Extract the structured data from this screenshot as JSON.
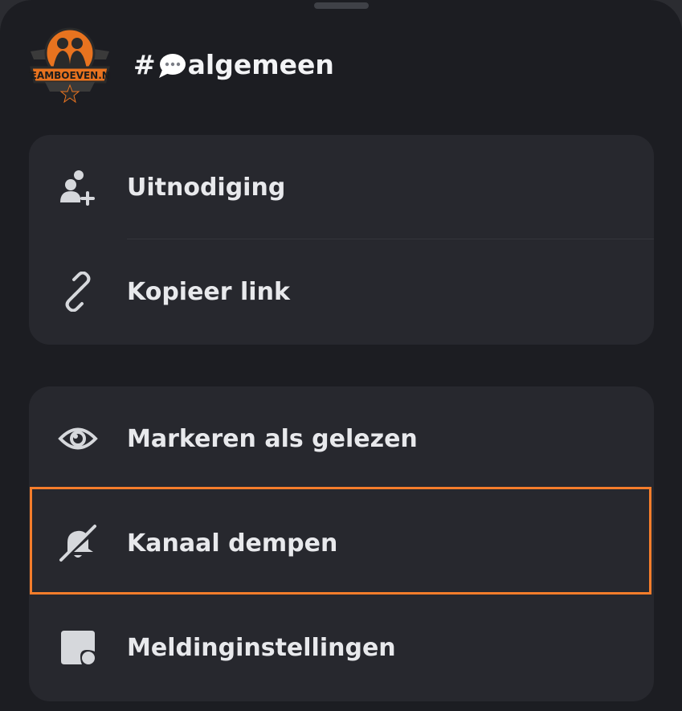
{
  "header": {
    "server_logo_text": "TEAMBOEVEN.NL",
    "channel_prefix": "#",
    "channel_emoji": "speech-bubble-emoji",
    "channel_name": "algemeen"
  },
  "groups": [
    {
      "items": [
        {
          "label": "Uitnodiging",
          "icon": "add-friend-icon"
        },
        {
          "label": "Kopieer link",
          "icon": "link-icon"
        }
      ]
    },
    {
      "items": [
        {
          "label": "Markeren als gelezen",
          "icon": "eye-icon"
        },
        {
          "label": "Kanaal dempen",
          "icon": "bell-slash-icon",
          "highlighted": true
        },
        {
          "label": "Meldinginstellingen",
          "icon": "notification-settings-icon"
        }
      ]
    }
  ],
  "colors": {
    "background": "#1c1d22",
    "card": "#27282e",
    "text": "#e8e9ec",
    "icon": "#d6d8dc",
    "highlight": "#f57d2b"
  }
}
